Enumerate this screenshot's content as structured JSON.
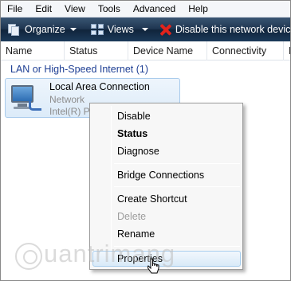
{
  "menubar": {
    "items": [
      "File",
      "Edit",
      "View",
      "Tools",
      "Advanced",
      "Help"
    ]
  },
  "toolbar": {
    "organize": "Organize",
    "views": "Views",
    "disable": "Disable this network device"
  },
  "columns": [
    "Name",
    "Status",
    "Device Name",
    "Connectivity",
    "N"
  ],
  "group": {
    "title": "LAN or High-Speed Internet (1)"
  },
  "connection": {
    "name": "Local Area Connection",
    "status": "Network",
    "device": "Intel(R) Pl"
  },
  "context_menu": {
    "items": [
      {
        "label": "Disable",
        "style": "normal"
      },
      {
        "label": "Status",
        "style": "bold"
      },
      {
        "label": "Diagnose",
        "style": "normal"
      },
      {
        "label": "Bridge Connections",
        "style": "normal"
      },
      {
        "label": "Create Shortcut",
        "style": "normal"
      },
      {
        "label": "Delete",
        "style": "disabled"
      },
      {
        "label": "Rename",
        "style": "normal"
      },
      {
        "label": "Properties",
        "style": "highlighted"
      }
    ]
  },
  "watermark": {
    "text": "uantrimang"
  },
  "colors": {
    "toolbar": "#1e3550",
    "group_text": "#1e3f94",
    "highlight_border": "#a7cdee",
    "disable_icon": "#e3231b"
  },
  "icons": [
    "organize-icon",
    "views-icon",
    "disable-x-icon",
    "computer-network-icon",
    "mouse-cursor-icon"
  ]
}
